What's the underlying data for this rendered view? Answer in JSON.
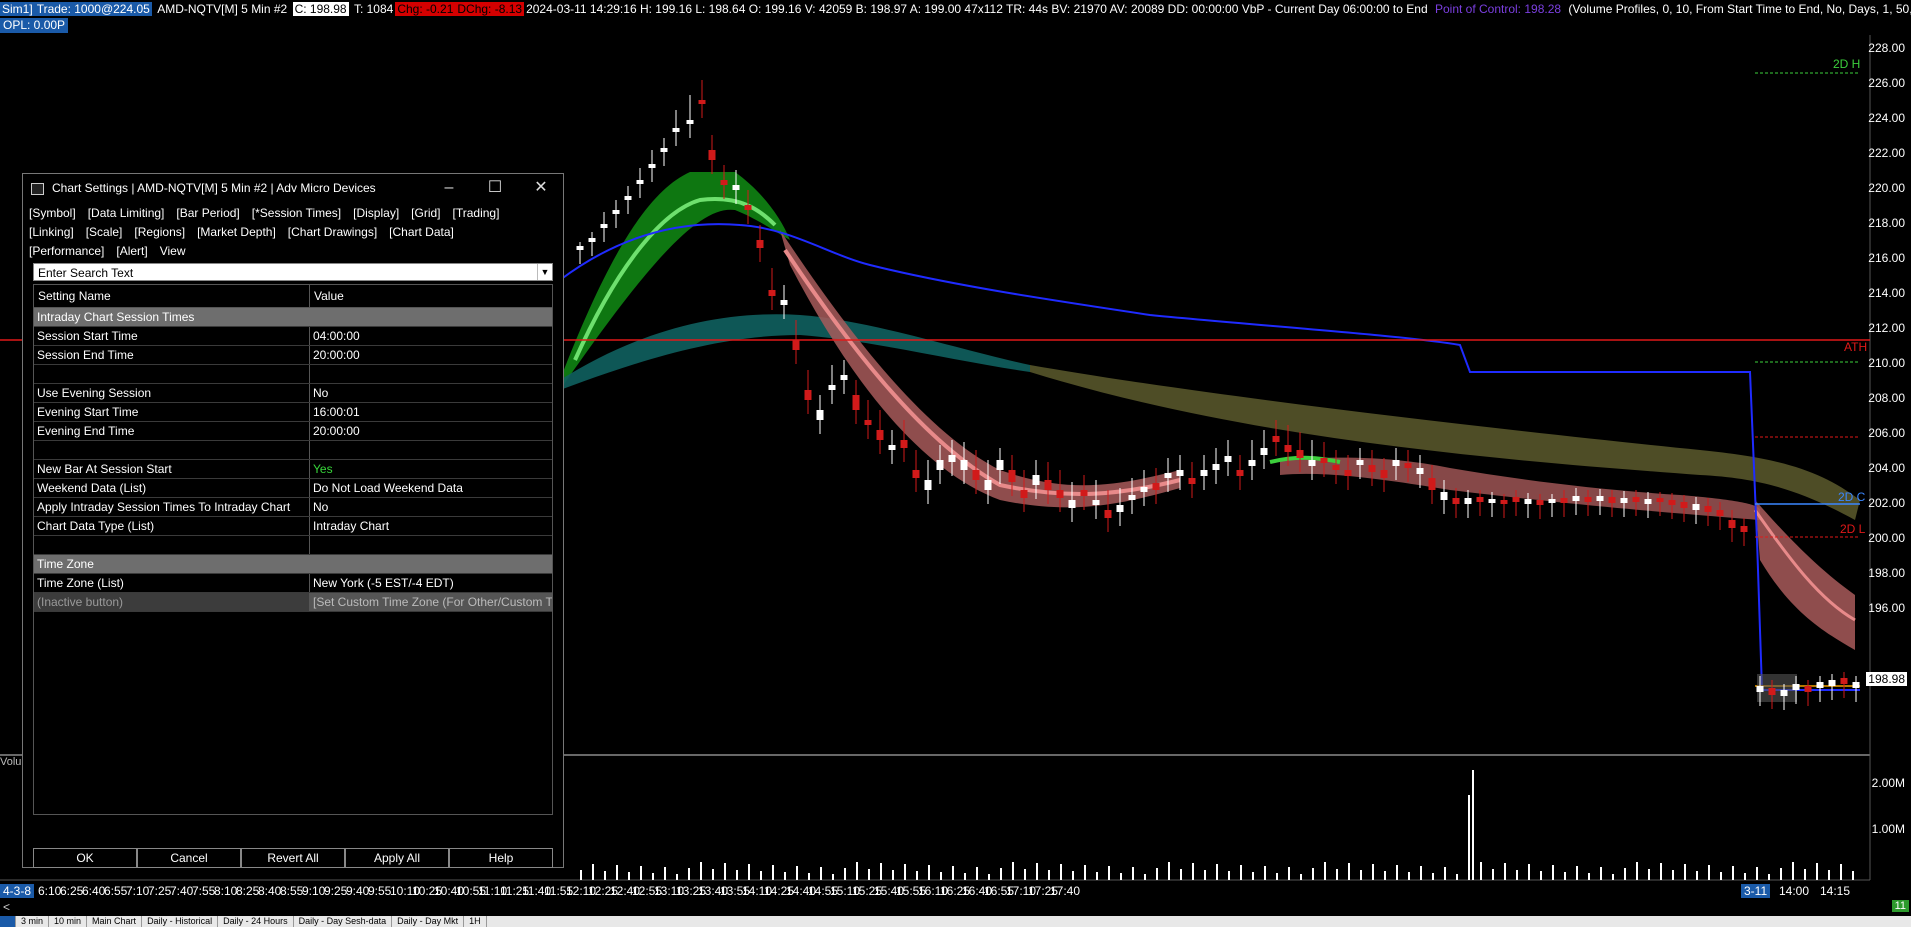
{
  "header": {
    "sim": "Sim1]",
    "trade": "Trade: 1000@224.05",
    "symbol": "AMD-NQTV[M]  5 Min  #2",
    "close_box": "C: 198.98",
    "ticks": "T: 1084",
    "chg": "Chg: -0.21",
    "dchg": "DChg: -8.13",
    "stats": "2024-03-11 14:29:16 H: 199.16 L: 198.64 O: 199.16 V: 42059 B: 198.97 A: 199.00 47x112 TR: 44s BV: 21970 AV: 20089 DD: 00:00:00 VbP - Current Day 06:00:00 to End",
    "poc": "Point of Control: 198.28",
    "vp": "(Volume Profiles, 0, 10, From Start Time to End, No, Days, 1, 50,",
    "opl": "OPL: 0.00P"
  },
  "y_axis": [
    "228.00",
    "226.00",
    "224.00",
    "222.00",
    "220.00",
    "218.00",
    "216.00",
    "214.00",
    "212.00",
    "210.00",
    "208.00",
    "206.00",
    "204.00",
    "202.00",
    "200.00",
    "198.00",
    "196.00"
  ],
  "vol_axis": [
    "2.00M",
    "1.00M"
  ],
  "x_axis": [
    "6:10",
    "6:25",
    "6:40",
    "6:55",
    "7:10",
    "7:25",
    "7:40",
    "7:55",
    "8:10",
    "8:25",
    "8:40",
    "8:55",
    "9:10",
    "9:25",
    "9:40",
    "9:55",
    "10:10",
    "10:25",
    "10:40",
    "10:55",
    "11:10",
    "11:25",
    "11:40",
    "11:55",
    "12:10",
    "12:25",
    "12:40",
    "12:55",
    "13:10",
    "13:25",
    "13:40",
    "13:55",
    "14:10",
    "14:25",
    "14:40",
    "14:55",
    "15:10",
    "15:25",
    "15:40",
    "15:55",
    "16:10",
    "16:25",
    "16:40",
    "16:55",
    "17:10",
    "17:25",
    "17:40",
    "14:00",
    "14:15"
  ],
  "x_first": "4-3-8",
  "date_marker": "3-11",
  "sr_labels": {
    "h2d": "2D H",
    "ath": "ATH",
    "c2d": "2D C",
    "l2d": "2D L"
  },
  "last_price": "198.98",
  "vol_label": "Volu",
  "scroll_num": "11",
  "dialog": {
    "title": "Chart Settings | AMD-NQTV[M]  5 Min  #2 | Adv Micro Devices",
    "tabs": [
      "[Symbol]",
      "[Data Limiting]",
      "[Bar Period]",
      "[*Session Times]",
      "[Display]",
      "[Grid]",
      "[Trading]",
      "[Linking]",
      "[Scale]",
      "[Regions]",
      "[Market Depth]",
      "[Chart Drawings]",
      "[Chart Data]",
      "[Performance]",
      "[Alert]",
      "View"
    ],
    "search_placeholder": "Enter Search Text",
    "col_setting": "Setting Name",
    "col_value": "Value",
    "rows": [
      {
        "type": "section",
        "name": "Intraday Chart Session Times"
      },
      {
        "type": "row",
        "name": "Session Start Time",
        "value": "04:00:00"
      },
      {
        "type": "row",
        "name": "Session End Time",
        "value": "20:00:00"
      },
      {
        "type": "blank"
      },
      {
        "type": "row",
        "name": "Use Evening Session",
        "value": "No"
      },
      {
        "type": "row",
        "name": "Evening Start Time",
        "value": "16:00:01"
      },
      {
        "type": "row",
        "name": "Evening End Time",
        "value": "20:00:00"
      },
      {
        "type": "blank"
      },
      {
        "type": "row",
        "name": "New Bar At Session Start",
        "value": "Yes",
        "green": true
      },
      {
        "type": "row",
        "name": "Weekend Data (List)",
        "value": "Do Not Load Weekend Data"
      },
      {
        "type": "row",
        "name": "Apply Intraday Session Times To Intraday Chart",
        "value": "No"
      },
      {
        "type": "row",
        "name": "Chart Data Type (List)",
        "value": "Intraday Chart"
      },
      {
        "type": "blank"
      },
      {
        "type": "section",
        "name": "Time Zone"
      },
      {
        "type": "row",
        "name": "Time Zone (List)",
        "value": "New York (-5 EST/-4 EDT)"
      },
      {
        "type": "inactive",
        "name": "(Inactive button)",
        "value": "[Set Custom Time Zone (For Other/Custom Ti"
      }
    ],
    "buttons": [
      "OK",
      "Cancel",
      "Revert All",
      "Apply All",
      "Help"
    ]
  },
  "bottom_tabs": [
    "",
    "3 min",
    "10 min",
    "Main Chart",
    "Daily - Historical",
    "Daily - 24 Hours",
    "Daily - Day Sesh-data",
    "Daily - Day Mkt",
    "1H"
  ],
  "colors": {
    "up": "#ffffff",
    "down": "#d11a1a",
    "vwap": "#1f2bff",
    "ath": "#e01919",
    "band_green": "#0f7d12",
    "band_red": "#a85a5a",
    "band_teal": "#10605f",
    "band_olive": "#56552a"
  }
}
